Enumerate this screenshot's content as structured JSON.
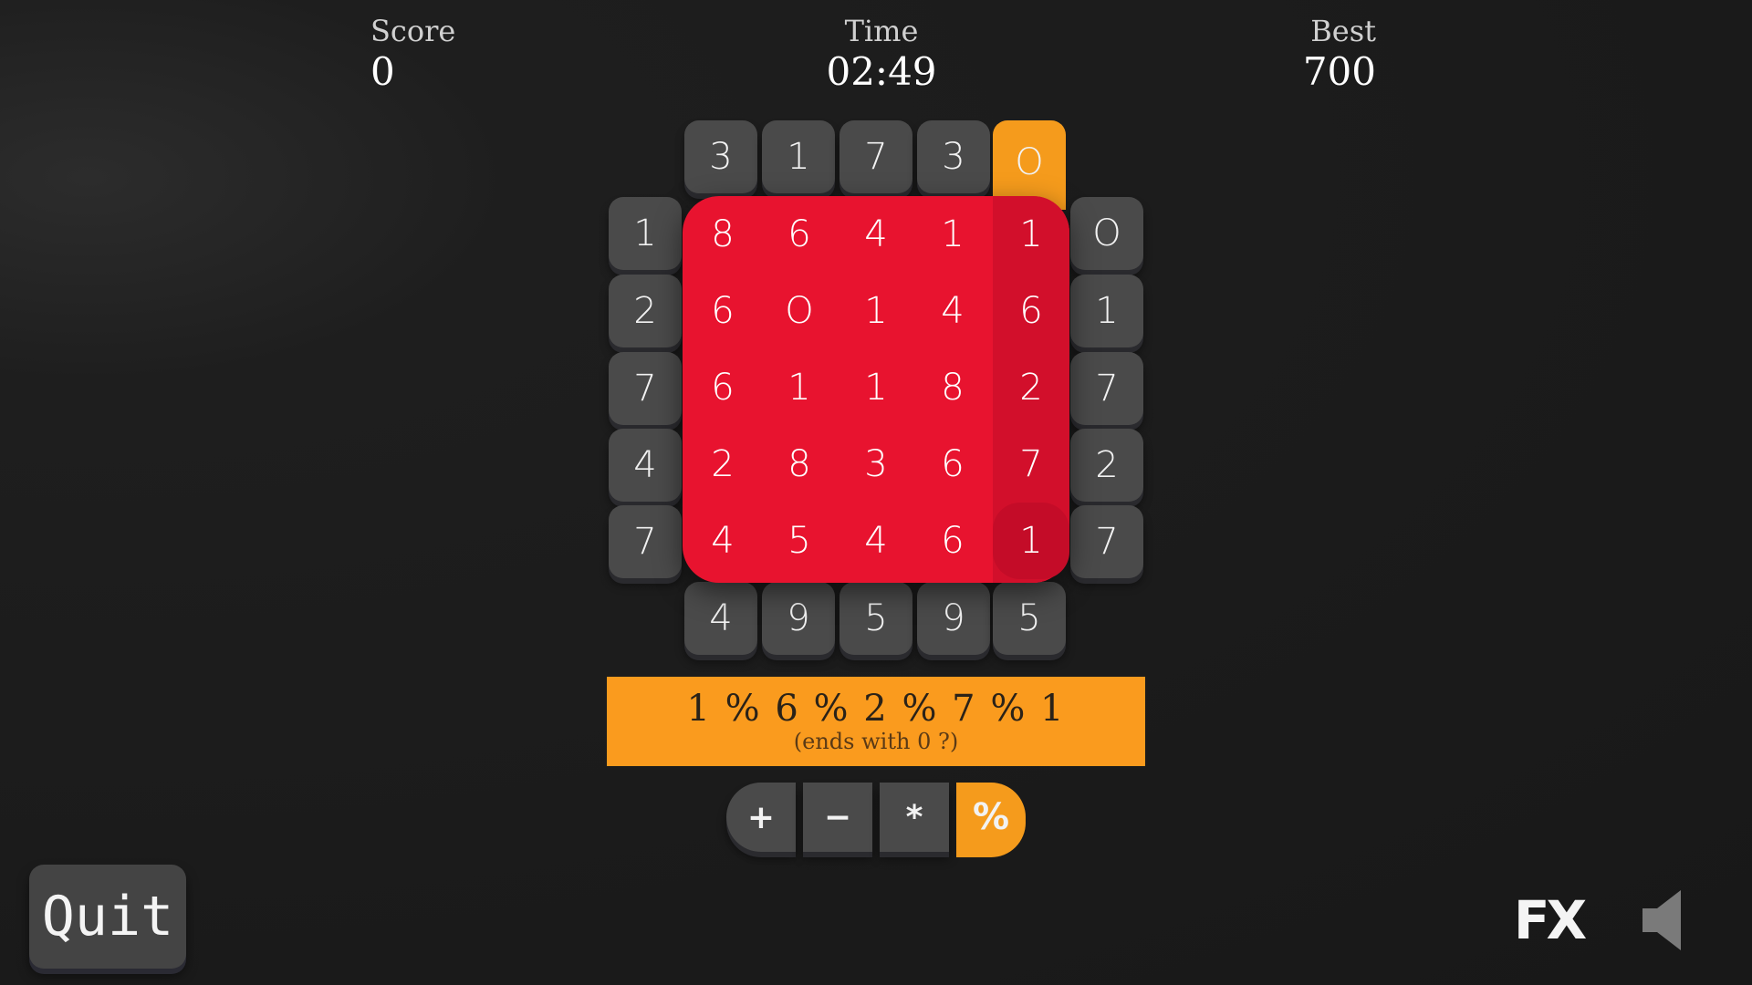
{
  "hud": {
    "score_label": "Score",
    "score_value": "0",
    "time_label": "Time",
    "time_value": "02:49",
    "best_label": "Best",
    "best_value": "700"
  },
  "top_row": [
    "3",
    "1",
    "7",
    "3",
    "O"
  ],
  "left_col": [
    "1",
    "2",
    "7",
    "4",
    "7"
  ],
  "right_col": [
    "O",
    "1",
    "7",
    "2",
    "7"
  ],
  "bottom_row": [
    "4",
    "9",
    "5",
    "9",
    "5"
  ],
  "grid": [
    [
      "8",
      "6",
      "4",
      "1",
      "1"
    ],
    [
      "6",
      "O",
      "1",
      "4",
      "6"
    ],
    [
      "6",
      "1",
      "1",
      "8",
      "2"
    ],
    [
      "2",
      "8",
      "3",
      "6",
      "7"
    ],
    [
      "4",
      "5",
      "4",
      "6",
      "1"
    ]
  ],
  "expression": {
    "main": "1 % 6 % 2 % 7 % 1",
    "hint": "(ends with 0 ?)"
  },
  "operators": [
    "+",
    "−",
    "*",
    "%"
  ],
  "controls": {
    "quit_label": "Quit",
    "fx_label": "FX"
  },
  "colors": {
    "accent": "#f59b1c",
    "grid_red": "#e8132f",
    "tile": "#4a4a4a",
    "background": "#1b1b1b"
  },
  "icons": {
    "sound": "speaker-muted-icon"
  }
}
